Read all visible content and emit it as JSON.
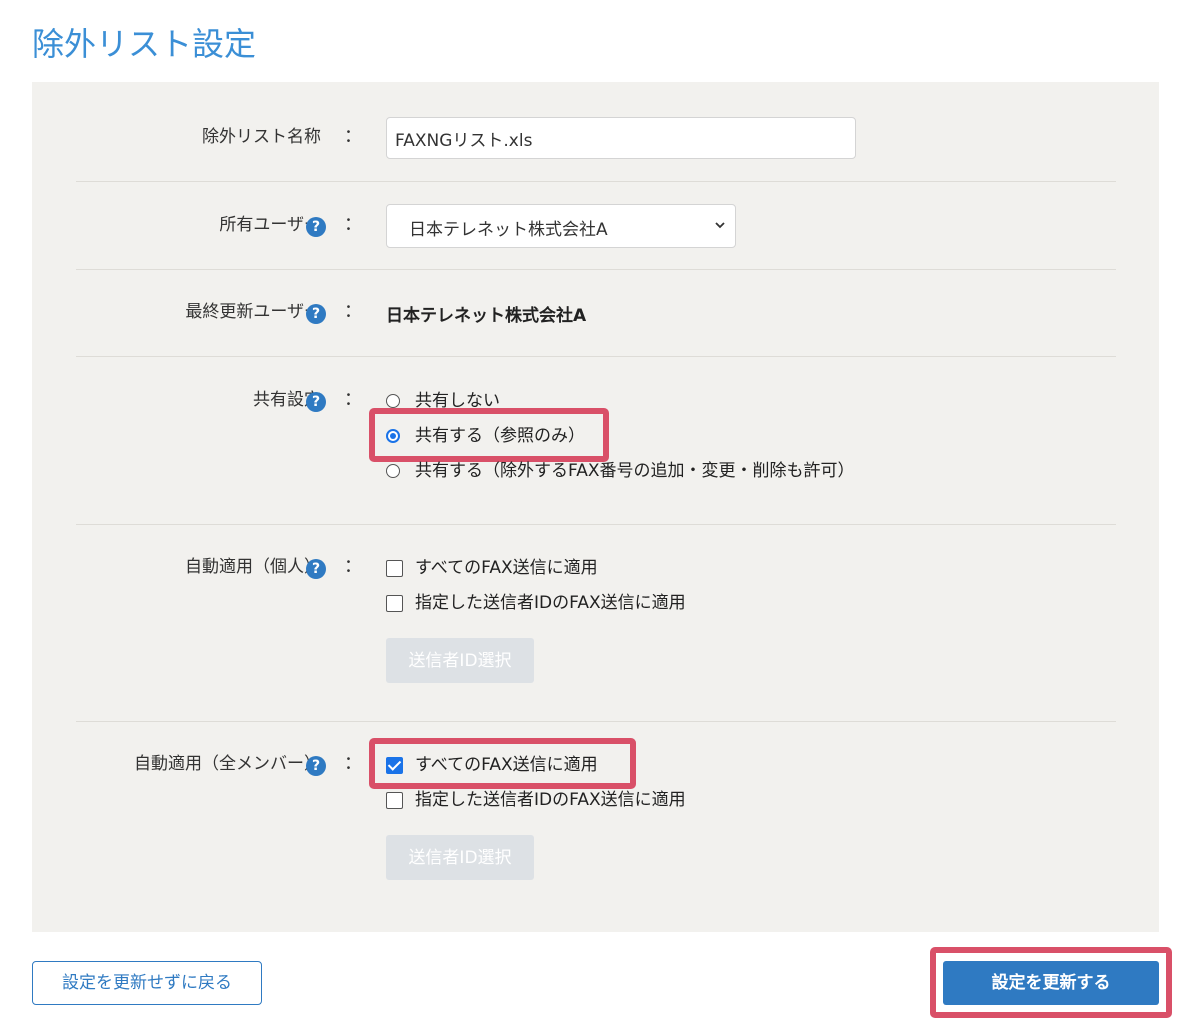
{
  "page": {
    "title": "除外リスト設定"
  },
  "form": {
    "name": {
      "label": "除外リスト名称",
      "colon": "：",
      "value": "FAXNGリスト.xls"
    },
    "owner": {
      "label": "所有ユーザー",
      "help": "?",
      "colon": "：",
      "selected": "日本テレネット株式会社A"
    },
    "last_updated_user": {
      "label": "最終更新ユーザー",
      "help": "?",
      "colon": "：",
      "value": "日本テレネット株式会社A"
    },
    "sharing": {
      "label": "共有設定",
      "help": "?",
      "colon": "：",
      "options": [
        {
          "label": "共有しない",
          "checked": false
        },
        {
          "label": "共有する（参照のみ）",
          "checked": true
        },
        {
          "label": "共有する（除外するFAX番号の追加・変更・削除も許可）",
          "checked": false
        }
      ]
    },
    "auto_personal": {
      "label": "自動適用（個人）",
      "help": "?",
      "colon": "：",
      "options": [
        {
          "label": "すべてのFAX送信に適用",
          "checked": false
        },
        {
          "label": "指定した送信者IDのFAX送信に適用",
          "checked": false
        }
      ],
      "button": "送信者ID選択"
    },
    "auto_all": {
      "label": "自動適用（全メンバー）",
      "help": "?",
      "colon": "：",
      "options": [
        {
          "label": "すべてのFAX送信に適用",
          "checked": true
        },
        {
          "label": "指定した送信者IDのFAX送信に適用",
          "checked": false
        }
      ],
      "button": "送信者ID選択"
    }
  },
  "actions": {
    "back": "設定を更新せずに戻る",
    "submit": "設定を更新する"
  },
  "colors": {
    "title": "#3b8fd6",
    "panel": "#f2f1ee",
    "primary": "#2f7ac2",
    "highlight": "#d95068",
    "checked": "#1a73e8"
  }
}
